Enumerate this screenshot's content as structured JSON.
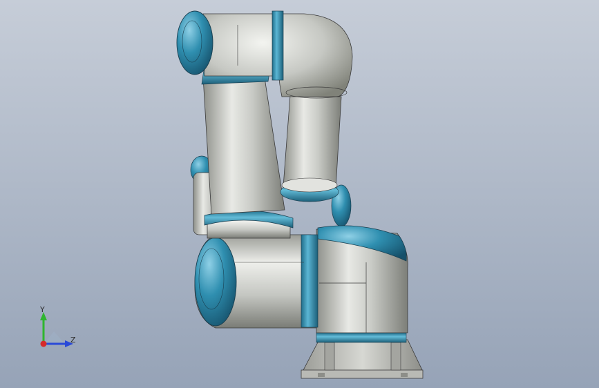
{
  "viewport": {
    "background_top": "#c6cdd8",
    "background_bottom": "#96a3b7",
    "accent_band_color": "#2f8fb0",
    "body_color": "#c9cbc6",
    "base_color": "#bebfb9"
  },
  "triad": {
    "y_label": "Y",
    "z_label": "Z",
    "y_color": "#2fb52f",
    "z_color": "#2a4ad8",
    "origin_color": "#d62a2a"
  }
}
